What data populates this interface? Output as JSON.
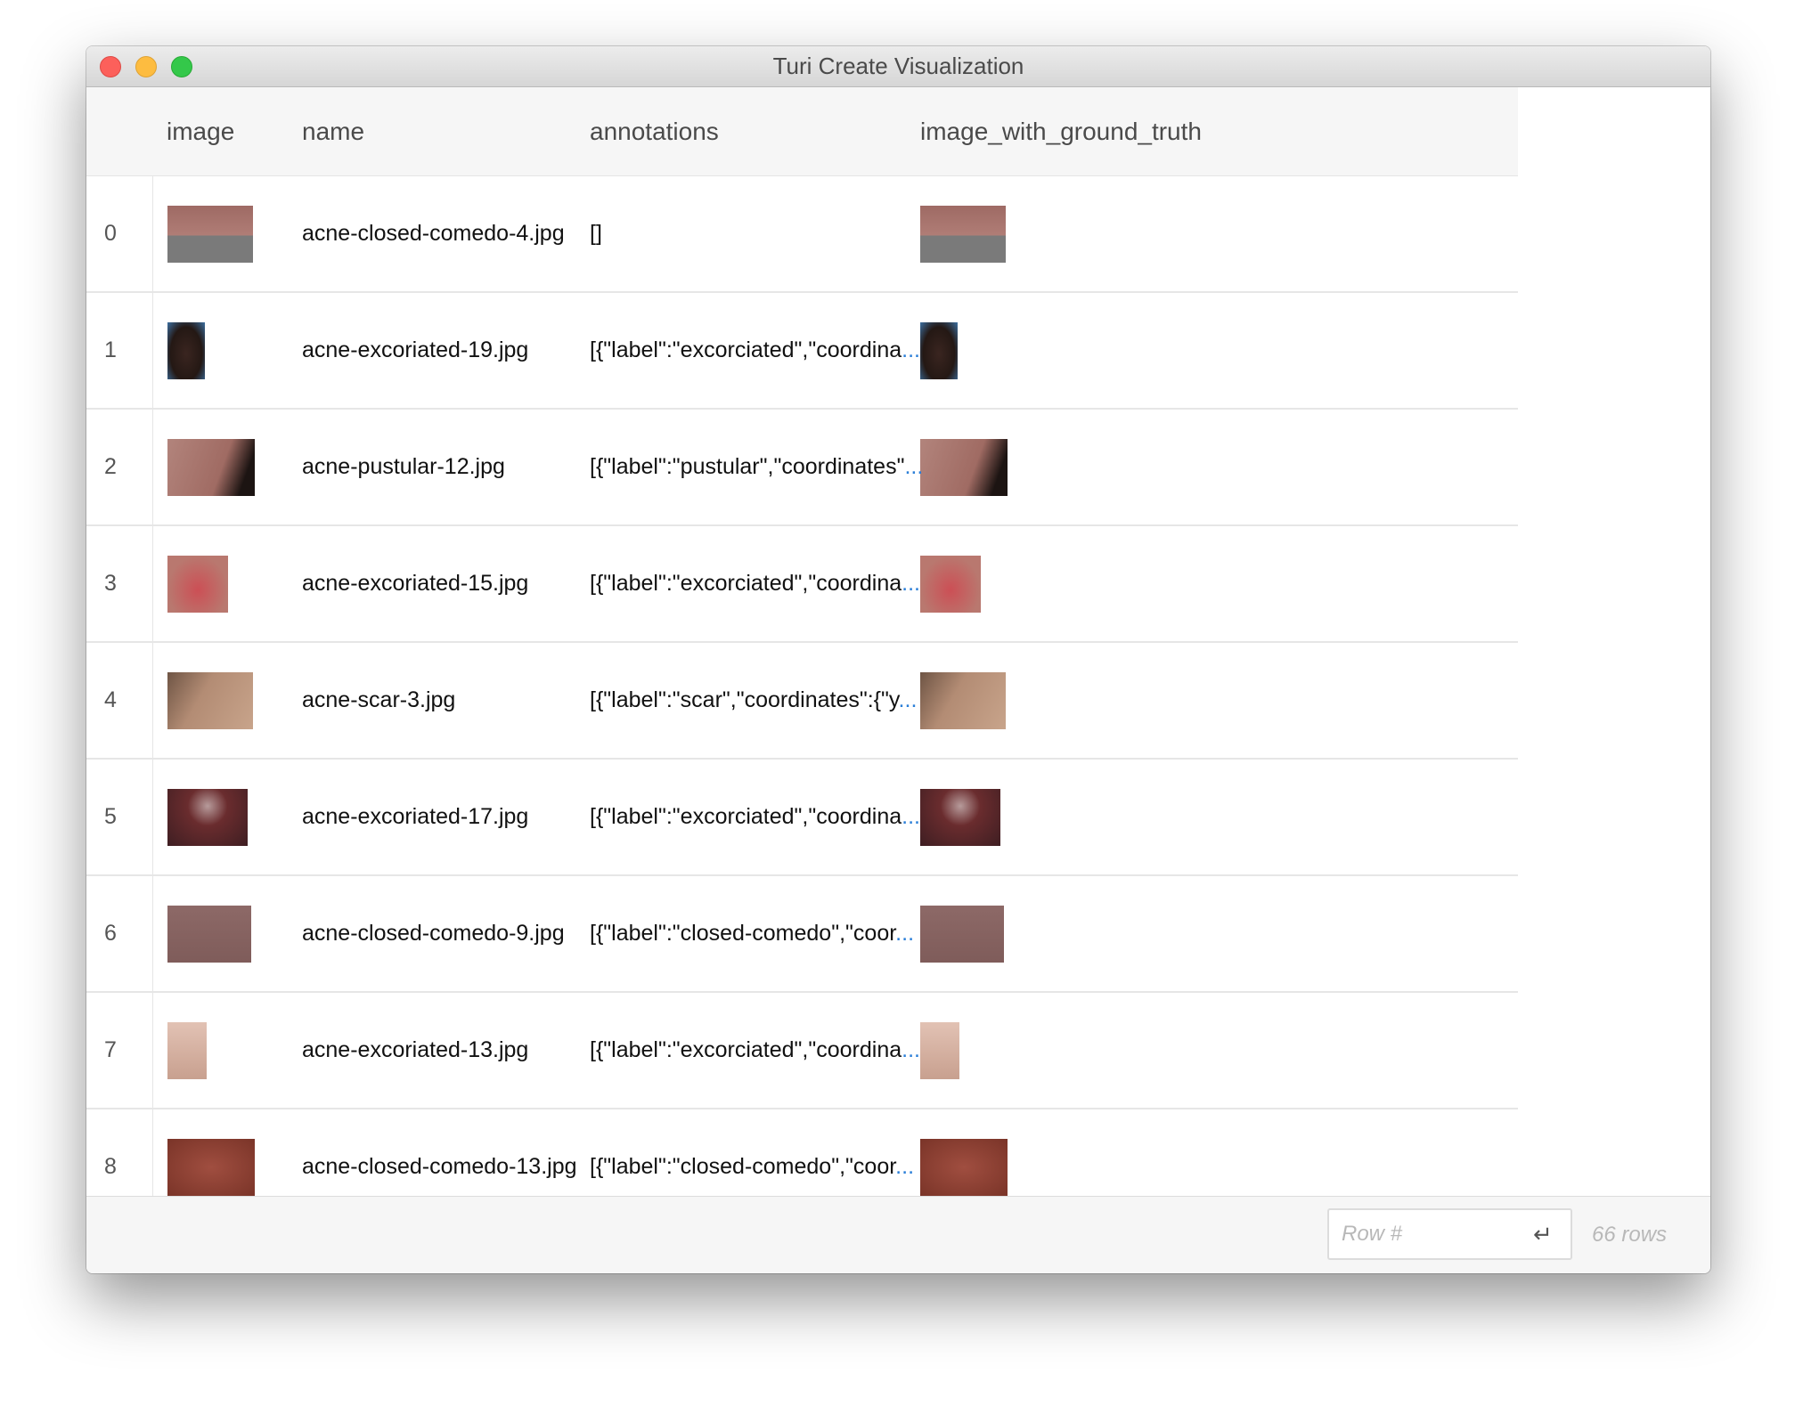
{
  "window": {
    "title": "Turi Create Visualization"
  },
  "columns": [
    "image",
    "name",
    "annotations",
    "image_with_ground_truth"
  ],
  "rows": [
    {
      "index": "0",
      "name": "acne-closed-comedo-4.jpg",
      "annotations": "[]",
      "annotations_truncated": false
    },
    {
      "index": "1",
      "name": "acne-excoriated-19.jpg",
      "annotations": "[{\"label\":\"excorciated\",\"coordina",
      "annotations_truncated": true
    },
    {
      "index": "2",
      "name": "acne-pustular-12.jpg",
      "annotations": "[{\"label\":\"pustular\",\"coordinates\"",
      "annotations_truncated": true
    },
    {
      "index": "3",
      "name": "acne-excoriated-15.jpg",
      "annotations": "[{\"label\":\"excorciated\",\"coordina",
      "annotations_truncated": true
    },
    {
      "index": "4",
      "name": "acne-scar-3.jpg",
      "annotations": "[{\"label\":\"scar\",\"coordinates\":{\"y",
      "annotations_truncated": true
    },
    {
      "index": "5",
      "name": "acne-excoriated-17.jpg",
      "annotations": "[{\"label\":\"excorciated\",\"coordina",
      "annotations_truncated": true
    },
    {
      "index": "6",
      "name": "acne-closed-comedo-9.jpg",
      "annotations": "[{\"label\":\"closed-comedo\",\"coor",
      "annotations_truncated": true
    },
    {
      "index": "7",
      "name": "acne-excoriated-13.jpg",
      "annotations": "[{\"label\":\"excorciated\",\"coordina",
      "annotations_truncated": true
    },
    {
      "index": "8",
      "name": "acne-closed-comedo-13.jpg",
      "annotations": "[{\"label\":\"closed-comedo\",\"coor",
      "annotations_truncated": true
    }
  ],
  "ellipsis": "...",
  "footer": {
    "row_placeholder": "Row #",
    "enter_icon": "↵",
    "row_count": "66 rows"
  },
  "colors": {
    "ellipsis": "#2b7fd8",
    "header_bg": "#f6f6f6",
    "close": "#fc605b",
    "minimize": "#fdbc40",
    "maximize": "#34c84a"
  }
}
